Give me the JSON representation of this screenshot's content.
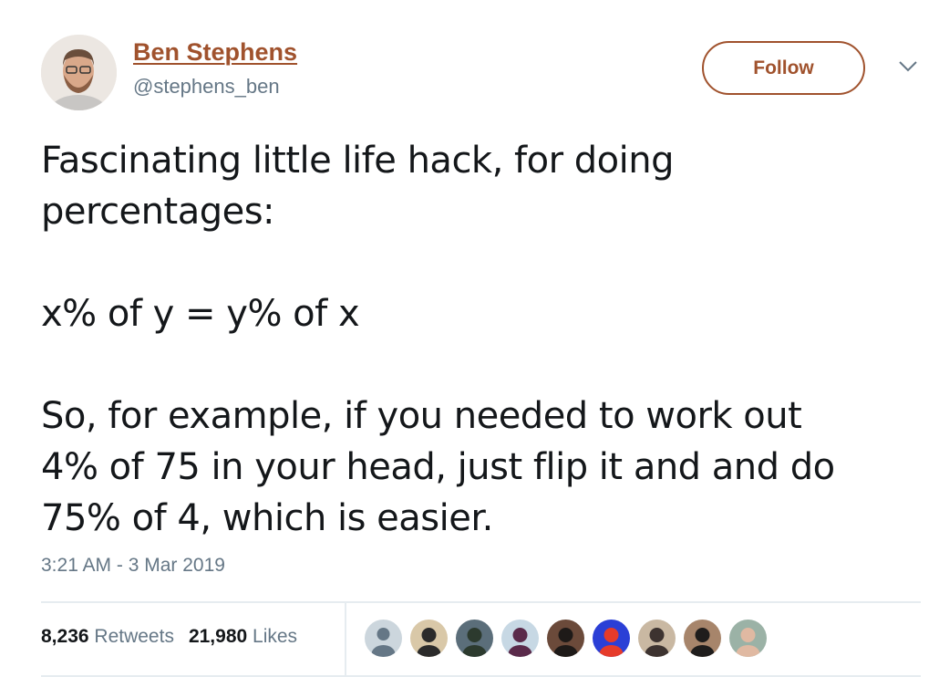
{
  "author": {
    "display_name": "Ben Stephens",
    "handle": "@stephens_ben",
    "avatar_icon": "user-photo-avatar"
  },
  "actions": {
    "follow_label": "Follow",
    "more_icon": "chevron-down-icon"
  },
  "tweet": {
    "lines": [
      "Fascinating little life hack, for doing",
      "percentages:",
      "",
      "x% of y = y% of x",
      "",
      "So, for example, if you needed to work out",
      "4% of 75 in your head, just flip it and and do",
      "75% of 4, which is easier."
    ],
    "timestamp": "3:21 AM - 3 Mar 2019"
  },
  "stats": {
    "retweets_count": "8,236",
    "retweets_label": "Retweets",
    "likes_count": "21,980",
    "likes_label": "Likes"
  },
  "likers": [
    {
      "name": "default-profile",
      "colors": [
        "#ccd6dd",
        "#657786"
      ]
    },
    {
      "name": "beach-man",
      "colors": [
        "#d9c8a8",
        "#2b2b2b"
      ]
    },
    {
      "name": "group-sunglasses",
      "colors": [
        "#5b6e7a",
        "#2c3a2e"
      ]
    },
    {
      "name": "party-hat",
      "colors": [
        "#c7d8e4",
        "#5a2a4a"
      ]
    },
    {
      "name": "beanie-smile",
      "colors": [
        "#6b4a3a",
        "#1e1a18"
      ]
    },
    {
      "name": "rainbow-pattern",
      "colors": [
        "#2b3fd6",
        "#e63b2a"
      ]
    },
    {
      "name": "couple",
      "colors": [
        "#c9b8a2",
        "#3d3330"
      ]
    },
    {
      "name": "dog",
      "colors": [
        "#a7856b",
        "#1f1d1c"
      ]
    },
    {
      "name": "family-selfie",
      "colors": [
        "#9bb2a6",
        "#e0b9a2"
      ]
    }
  ],
  "colors": {
    "accent": "#a0522d",
    "secondary_text": "#657786",
    "primary_text": "#14171a",
    "divider": "#e6ecf0"
  }
}
